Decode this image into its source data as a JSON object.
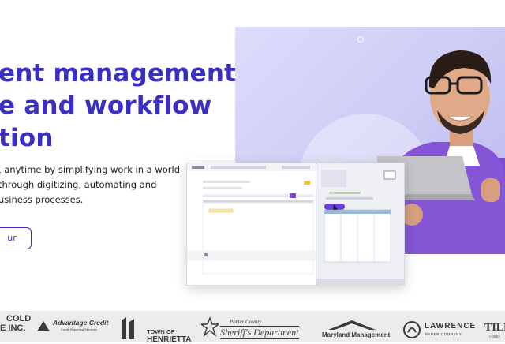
{
  "hero": {
    "headline_lines": [
      "ent management",
      "e and workflow",
      "tion"
    ],
    "lede_lines": [
      ", anytime by simplifying work in a world",
      "through digitizing, automating and",
      "usiness processes."
    ],
    "cta_label": "ur"
  },
  "logos": [
    {
      "name": "cold-inc",
      "lines": [
        "COLD",
        "E INC."
      ]
    },
    {
      "name": "advantage-credit",
      "lines": [
        "Advantage Credit",
        "Credit Reporting Services"
      ]
    },
    {
      "name": "town-of-henrietta",
      "lines": [
        "TOWN OF",
        "HENRIETTA"
      ]
    },
    {
      "name": "porter-county-sheriff",
      "lines": [
        "Porter County",
        "Sheriff's Department"
      ]
    },
    {
      "name": "maryland-management",
      "lines": [
        "Maryland Management"
      ]
    },
    {
      "name": "lawrence-paper",
      "lines": [
        "LAWRENCE",
        "PAPER COMPANY"
      ]
    },
    {
      "name": "tilden",
      "lines": [
        "TILD",
        "COMPA"
      ]
    }
  ],
  "colors": {
    "brand": "#3b2fc1",
    "hero_bg": "#cfcff6",
    "accent_purple": "#6a3fd3"
  }
}
